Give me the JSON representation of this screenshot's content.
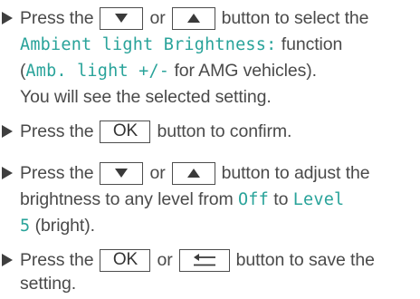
{
  "steps": [
    {
      "line1": {
        "t1": "Press the",
        "t2": "or",
        "t3": "button to select the"
      },
      "line2": {
        "hl": "Ambient light Brightness:",
        "t": " function"
      },
      "line3": {
        "open": "(",
        "hl": "Amb. light +/-",
        "t": " for AMG vehicles)."
      },
      "line4": {
        "t": "You will see the selected setting."
      }
    },
    {
      "line1": {
        "t1": "Press the",
        "key": "OK",
        "t2": "button to confirm."
      }
    },
    {
      "line1": {
        "t1": "Press the",
        "t2": "or",
        "t3": "button to adjust the"
      },
      "line2": {
        "t1": "brightness to any level from ",
        "hl1": "Off",
        "t2": " to ",
        "hl2": "Level"
      },
      "line3": {
        "hl": "5",
        "t": " (bright)."
      }
    },
    {
      "line1": {
        "t1": "Press the",
        "key": "OK",
        "t2": "or",
        "t3": "button to save the"
      },
      "line2": {
        "t": "setting."
      }
    }
  ],
  "icons": {
    "down": "triangle-down-icon",
    "up": "triangle-up-icon",
    "back": "back-arrow-icon",
    "bullet": "bullet-triangle-icon"
  },
  "colors": {
    "text": "#4a4a4a",
    "highlight": "#29a39a",
    "key_border": "#4d4d4d"
  }
}
